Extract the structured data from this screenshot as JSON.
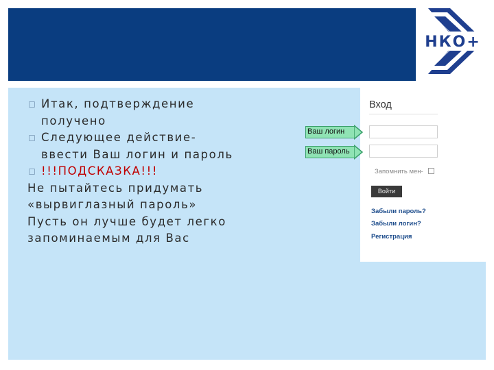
{
  "slide": {
    "bullets": [
      {
        "text": "Итак, подтверждение получено"
      },
      {
        "text": "Следующее действие- ввести Ваш логин и пароль"
      },
      {
        "text": "!!!ПОДСКАЗКА!!!"
      }
    ],
    "paragraph_lines": [
      "Не пытайтесь придумать",
      "«вырвиглазный пароль»",
      "Пусть он лучше будет легко",
      "запоминаемым для Вас"
    ],
    "logo": {
      "text": "НКО+",
      "color": "#1f3f8f"
    },
    "colors": {
      "header": "#0a3d80",
      "panel": "#c5e4f8",
      "hint": "#c00000",
      "callout": "#8fe3b4"
    }
  },
  "login": {
    "title": "Вход",
    "callouts": {
      "login_label": "Ваш логин",
      "password_label": "Ваш пароль"
    },
    "login_value": "",
    "password_value": "",
    "remember_label": "Запомнить мен-",
    "remember_checked": false,
    "submit_label": "Войти",
    "links": {
      "forgot_password": "Забыли пароль?",
      "forgot_login": "Забыли логин?",
      "register": "Регистрация"
    }
  }
}
